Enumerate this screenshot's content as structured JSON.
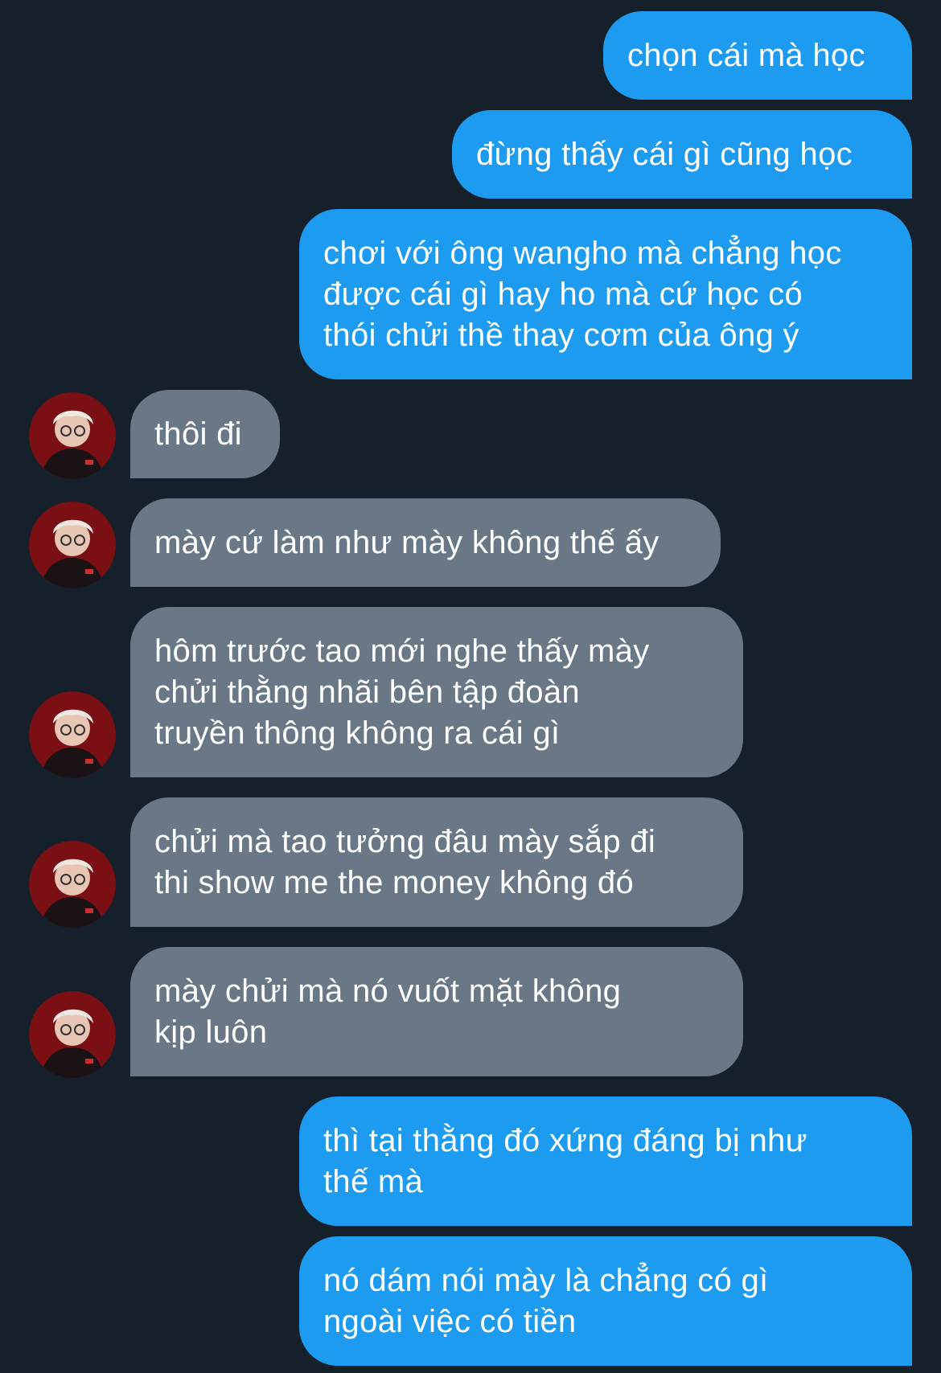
{
  "conversation": {
    "messages": [
      {
        "side": "out",
        "text": "chọn cái mà học"
      },
      {
        "side": "out",
        "text": "đừng thấy cái gì cũng học"
      },
      {
        "side": "out",
        "text": "chơi với ông wangho mà chẳng học\nđược cái gì hay ho mà cứ học có\nthói chửi thề thay cơm của ông ý"
      },
      {
        "side": "in",
        "text": "thôi đi"
      },
      {
        "side": "in",
        "text": "mày cứ làm như mày không thế ấy"
      },
      {
        "side": "in",
        "text": "hôm trước tao mới nghe thấy mày\nchửi thằng nhãi bên tập đoàn\ntruyền thông không ra cái gì"
      },
      {
        "side": "in",
        "text": "chửi mà tao tưởng đâu mày sắp đi\nthi show me the money không đó"
      },
      {
        "side": "in",
        "text": "mày chửi mà nó vuốt mặt không\nkịp luôn"
      },
      {
        "side": "out",
        "text": "thì tại thằng đó xứng đáng bị như\nthế mà"
      },
      {
        "side": "out",
        "text": "nó dám nói mày là chẳng có gì\nngoài việc có tiền"
      }
    ]
  },
  "colors": {
    "background": "#15202b",
    "outgoing_bubble": "#1d9bf0",
    "incoming_bubble": "#6a7787",
    "text": "#ffffff"
  },
  "icons": {
    "contact_avatar": "contact-avatar-photo"
  }
}
